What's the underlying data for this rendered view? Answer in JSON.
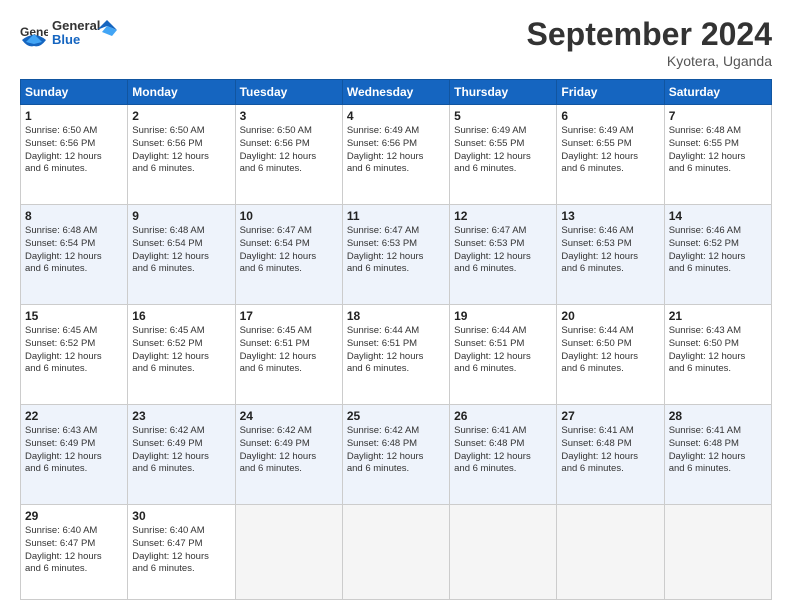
{
  "header": {
    "logo_general": "General",
    "logo_blue": "Blue",
    "month_title": "September 2024",
    "location": "Kyotera, Uganda"
  },
  "days_of_week": [
    "Sunday",
    "Monday",
    "Tuesday",
    "Wednesday",
    "Thursday",
    "Friday",
    "Saturday"
  ],
  "weeks": [
    [
      {
        "day": "1",
        "sunrise": "6:50 AM",
        "sunset": "6:56 PM",
        "daylight": "12 hours and 6 minutes."
      },
      {
        "day": "2",
        "sunrise": "6:50 AM",
        "sunset": "6:56 PM",
        "daylight": "12 hours and 6 minutes."
      },
      {
        "day": "3",
        "sunrise": "6:50 AM",
        "sunset": "6:56 PM",
        "daylight": "12 hours and 6 minutes."
      },
      {
        "day": "4",
        "sunrise": "6:49 AM",
        "sunset": "6:56 PM",
        "daylight": "12 hours and 6 minutes."
      },
      {
        "day": "5",
        "sunrise": "6:49 AM",
        "sunset": "6:55 PM",
        "daylight": "12 hours and 6 minutes."
      },
      {
        "day": "6",
        "sunrise": "6:49 AM",
        "sunset": "6:55 PM",
        "daylight": "12 hours and 6 minutes."
      },
      {
        "day": "7",
        "sunrise": "6:48 AM",
        "sunset": "6:55 PM",
        "daylight": "12 hours and 6 minutes."
      }
    ],
    [
      {
        "day": "8",
        "sunrise": "6:48 AM",
        "sunset": "6:54 PM",
        "daylight": "12 hours and 6 minutes."
      },
      {
        "day": "9",
        "sunrise": "6:48 AM",
        "sunset": "6:54 PM",
        "daylight": "12 hours and 6 minutes."
      },
      {
        "day": "10",
        "sunrise": "6:47 AM",
        "sunset": "6:54 PM",
        "daylight": "12 hours and 6 minutes."
      },
      {
        "day": "11",
        "sunrise": "6:47 AM",
        "sunset": "6:53 PM",
        "daylight": "12 hours and 6 minutes."
      },
      {
        "day": "12",
        "sunrise": "6:47 AM",
        "sunset": "6:53 PM",
        "daylight": "12 hours and 6 minutes."
      },
      {
        "day": "13",
        "sunrise": "6:46 AM",
        "sunset": "6:53 PM",
        "daylight": "12 hours and 6 minutes."
      },
      {
        "day": "14",
        "sunrise": "6:46 AM",
        "sunset": "6:52 PM",
        "daylight": "12 hours and 6 minutes."
      }
    ],
    [
      {
        "day": "15",
        "sunrise": "6:45 AM",
        "sunset": "6:52 PM",
        "daylight": "12 hours and 6 minutes."
      },
      {
        "day": "16",
        "sunrise": "6:45 AM",
        "sunset": "6:52 PM",
        "daylight": "12 hours and 6 minutes."
      },
      {
        "day": "17",
        "sunrise": "6:45 AM",
        "sunset": "6:51 PM",
        "daylight": "12 hours and 6 minutes."
      },
      {
        "day": "18",
        "sunrise": "6:44 AM",
        "sunset": "6:51 PM",
        "daylight": "12 hours and 6 minutes."
      },
      {
        "day": "19",
        "sunrise": "6:44 AM",
        "sunset": "6:51 PM",
        "daylight": "12 hours and 6 minutes."
      },
      {
        "day": "20",
        "sunrise": "6:44 AM",
        "sunset": "6:50 PM",
        "daylight": "12 hours and 6 minutes."
      },
      {
        "day": "21",
        "sunrise": "6:43 AM",
        "sunset": "6:50 PM",
        "daylight": "12 hours and 6 minutes."
      }
    ],
    [
      {
        "day": "22",
        "sunrise": "6:43 AM",
        "sunset": "6:49 PM",
        "daylight": "12 hours and 6 minutes."
      },
      {
        "day": "23",
        "sunrise": "6:42 AM",
        "sunset": "6:49 PM",
        "daylight": "12 hours and 6 minutes."
      },
      {
        "day": "24",
        "sunrise": "6:42 AM",
        "sunset": "6:49 PM",
        "daylight": "12 hours and 6 minutes."
      },
      {
        "day": "25",
        "sunrise": "6:42 AM",
        "sunset": "6:48 PM",
        "daylight": "12 hours and 6 minutes."
      },
      {
        "day": "26",
        "sunrise": "6:41 AM",
        "sunset": "6:48 PM",
        "daylight": "12 hours and 6 minutes."
      },
      {
        "day": "27",
        "sunrise": "6:41 AM",
        "sunset": "6:48 PM",
        "daylight": "12 hours and 6 minutes."
      },
      {
        "day": "28",
        "sunrise": "6:41 AM",
        "sunset": "6:48 PM",
        "daylight": "12 hours and 6 minutes."
      }
    ],
    [
      {
        "day": "29",
        "sunrise": "6:40 AM",
        "sunset": "6:47 PM",
        "daylight": "12 hours and 6 minutes."
      },
      {
        "day": "30",
        "sunrise": "6:40 AM",
        "sunset": "6:47 PM",
        "daylight": "12 hours and 6 minutes."
      },
      null,
      null,
      null,
      null,
      null
    ]
  ],
  "labels": {
    "sunrise": "Sunrise: ",
    "sunset": "Sunset: ",
    "daylight": "Daylight: "
  }
}
